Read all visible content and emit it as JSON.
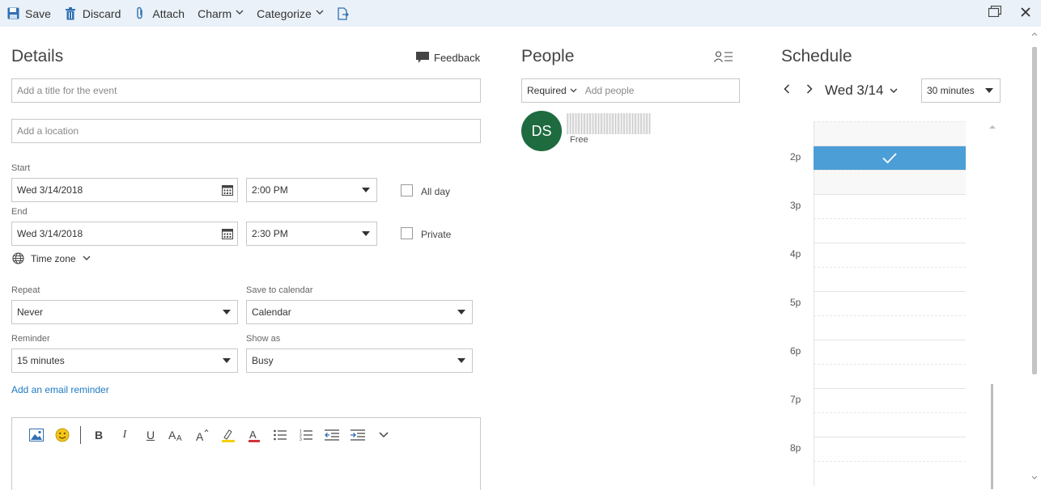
{
  "toolbar": {
    "save": "Save",
    "discard": "Discard",
    "attach": "Attach",
    "charm": "Charm",
    "categorize": "Categorize"
  },
  "details": {
    "heading": "Details",
    "feedback": "Feedback",
    "title_placeholder": "Add a title for the event",
    "location_placeholder": "Add a location",
    "start_label": "Start",
    "start_date": "Wed 3/14/2018",
    "start_time": "2:00 PM",
    "all_day": "All day",
    "end_label": "End",
    "end_date": "Wed 3/14/2018",
    "end_time": "2:30 PM",
    "private": "Private",
    "time_zone": "Time zone",
    "repeat_label": "Repeat",
    "repeat_value": "Never",
    "save_to_label": "Save to calendar",
    "save_to_value": "Calendar",
    "reminder_label": "Reminder",
    "reminder_value": "15 minutes",
    "show_as_label": "Show as",
    "show_as_value": "Busy",
    "email_reminder": "Add an email reminder"
  },
  "people": {
    "heading": "People",
    "required": "Required",
    "add_placeholder": "Add people",
    "attendee_initials": "DS",
    "attendee_status": "Free"
  },
  "schedule": {
    "heading": "Schedule",
    "date": "Wed 3/14",
    "interval": "30 minutes",
    "hours": [
      "2p",
      "3p",
      "4p",
      "5p",
      "6p",
      "7p",
      "8p"
    ]
  },
  "colors": {
    "accent": "#1f7bc4",
    "event": "#4c9ed6",
    "avatar": "#1d6b3f",
    "toolbar": "#eaf1f8"
  }
}
